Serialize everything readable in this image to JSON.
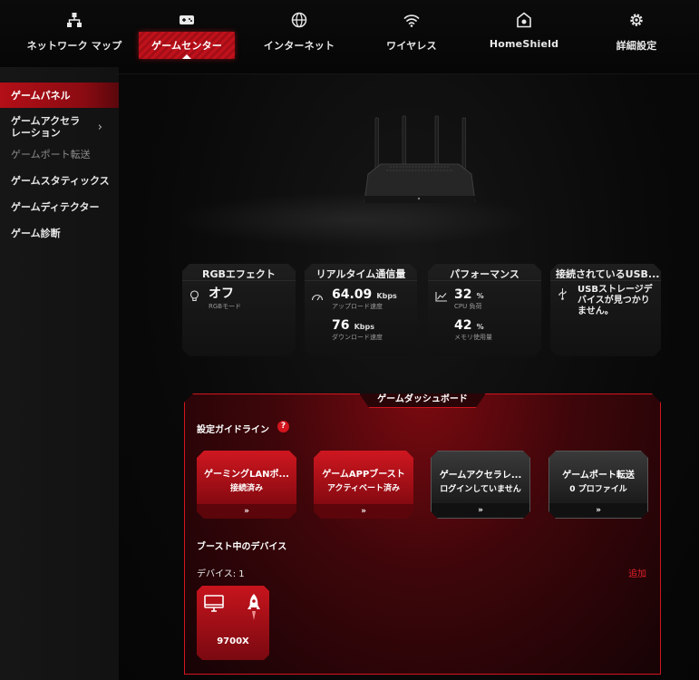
{
  "topnav": {
    "items": [
      {
        "label": "ネットワーク マップ",
        "icon": "network-map-icon"
      },
      {
        "label": "ゲームセンター",
        "icon": "gamepad-icon",
        "active": true
      },
      {
        "label": "インターネット",
        "icon": "globe-icon"
      },
      {
        "label": "ワイヤレス",
        "icon": "wifi-icon"
      },
      {
        "label": "HomeShield",
        "icon": "home-shield-icon"
      },
      {
        "label": "詳細設定",
        "icon": "gear-icon"
      }
    ]
  },
  "sidebar": {
    "items": [
      {
        "label": "ゲームパネル",
        "active": true
      },
      {
        "label": "ゲームアクセラ\nレーション",
        "has_submenu": true
      },
      {
        "label": "ゲームポート転送",
        "disabled": true
      },
      {
        "label": "ゲームスタティックス"
      },
      {
        "label": "ゲームディテクター"
      },
      {
        "label": "ゲーム診断"
      }
    ]
  },
  "cards": {
    "rgb": {
      "title": "RGBエフェクト",
      "value": "オフ",
      "sub": "RGBモード"
    },
    "traffic": {
      "title": "リアルタイム通信量",
      "upload_value": "64.09",
      "upload_unit": "Kbps",
      "upload_label": "アップロード速度",
      "download_value": "76",
      "download_unit": "Kbps",
      "download_label": "ダウンロード速度"
    },
    "performance": {
      "title": "パフォーマンス",
      "cpu_value": "32",
      "cpu_unit": "%",
      "cpu_label": "CPU 負荷",
      "mem_value": "42",
      "mem_unit": "%",
      "mem_label": "メモリ使用量"
    },
    "usb": {
      "title": "接続されているUSB...",
      "message": "USBストレージデバイスが見つかりません。"
    }
  },
  "dashboard": {
    "title": "ゲームダッシュボード",
    "guide_label": "設定ガイドライン",
    "help_icon": "?",
    "guides": [
      {
        "title": "ゲーミングLANポ...",
        "status": "接続済み",
        "style": "red"
      },
      {
        "title": "ゲームAPPブースト",
        "status": "アクティベート済み",
        "style": "red"
      },
      {
        "title": "ゲームアクセラレ...",
        "status": "ログインしていません",
        "style": "grey"
      },
      {
        "title": "ゲームポート転送",
        "status": "0 プロファイル",
        "style": "grey"
      }
    ],
    "arrow": "»",
    "boost_label": "ブースト中のデバイス",
    "device_count_label": "デバイス: 1",
    "add_label": "追加",
    "device": {
      "name": "9700X"
    }
  },
  "colors": {
    "accent": "#d2151e",
    "active_red": "#b30f17",
    "background": "#000000"
  }
}
